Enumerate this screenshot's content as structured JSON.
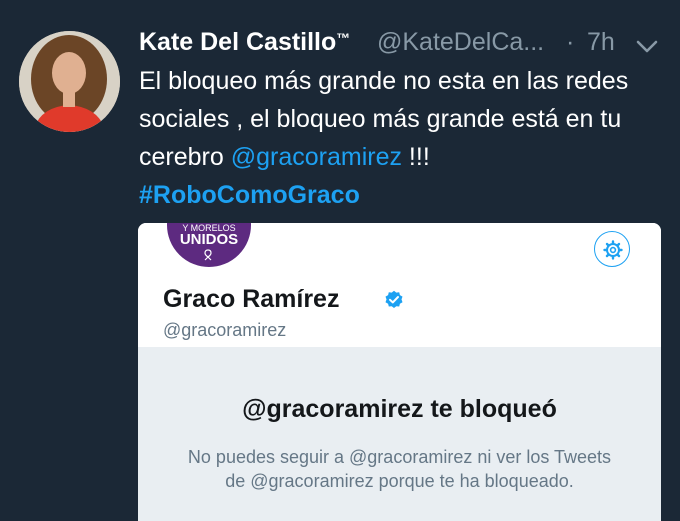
{
  "tweet": {
    "author_name": "Kate Del Castillo",
    "trademark": "™",
    "handle": "@KateDelCa...",
    "separator": "·",
    "time": "7h",
    "text_part1": "El bloqueo más grande no esta en las redes sociales , el bloqueo más grande está en tu cerebro ",
    "mention": "@gracoramirez",
    "text_part2": " !!!",
    "hashtag": "#RoboComoGraco"
  },
  "card": {
    "badge_line1": "Y MORELOS",
    "badge_line2": "UNIDOS",
    "profile_name": "Graco Ramírez",
    "profile_handle": "@gracoramirez",
    "blocked_title": "@gracoramirez te bloqueó",
    "blocked_description": "No puedes seguir a @gracoramirez ni ver los Tweets de @gracoramirez porque te ha bloqueado."
  },
  "icons": {
    "caret": "chevron-down-icon",
    "settings": "gear-icon",
    "verified": "verified-badge-icon"
  },
  "colors": {
    "background": "#1b2836",
    "link": "#1da1f2",
    "muted": "#8899a6",
    "badge_purple": "#5d2a80"
  }
}
